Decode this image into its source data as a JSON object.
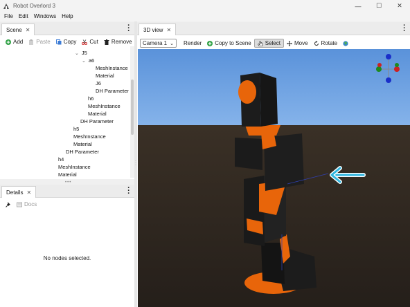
{
  "window": {
    "title": "Robot Overlord 3",
    "controls": [
      "minimize",
      "maximize",
      "close"
    ]
  },
  "menu": [
    "File",
    "Edit",
    "Windows",
    "Help"
  ],
  "scene_panel": {
    "tab_label": "Scene",
    "toolbar": {
      "add": "Add",
      "paste": "Paste",
      "copy": "Copy",
      "cut": "Cut",
      "remove": "Remove"
    },
    "tree": [
      {
        "label": "J5",
        "depth": 1,
        "expanded": true
      },
      {
        "label": "a6",
        "depth": 2,
        "expanded": true
      },
      {
        "label": "MeshInstance",
        "depth": 3
      },
      {
        "label": "Material",
        "depth": 3
      },
      {
        "label": "J6",
        "depth": 3
      },
      {
        "label": "DH Parameter",
        "depth": 3
      },
      {
        "label": "h6",
        "depth": 2
      },
      {
        "label": "MeshInstance",
        "depth": 2
      },
      {
        "label": "Material",
        "depth": 2
      },
      {
        "label": "DH Parameter",
        "depth": 1.5
      },
      {
        "label": "h5",
        "depth": 0.7
      },
      {
        "label": "MeshInstance",
        "depth": 0.7
      },
      {
        "label": "Material",
        "depth": 0.7
      },
      {
        "label": "DH Parameter",
        "depth": 0.35
      },
      {
        "label": "h4",
        "depth": 0
      },
      {
        "label": "MeshInstance",
        "depth": 0
      },
      {
        "label": "Material",
        "depth": 0
      }
    ]
  },
  "details_panel": {
    "tab_label": "Details",
    "docs_label": "Docs",
    "empty_message": "No nodes selected."
  },
  "view_panel": {
    "tab_label": "3D view",
    "camera_select": "Camera 1",
    "toolbar": {
      "render": "Render",
      "copy_to_scene": "Copy to Scene",
      "select": "Select",
      "move": "Move",
      "rotate": "Rotate"
    },
    "active_tool": "Select"
  },
  "colors": {
    "sky": "#6a9fe0",
    "ground": "#2b2622",
    "robot_orange": "#e8650a",
    "robot_black": "#1c1c1c",
    "arrow": "#2fb6e0"
  }
}
